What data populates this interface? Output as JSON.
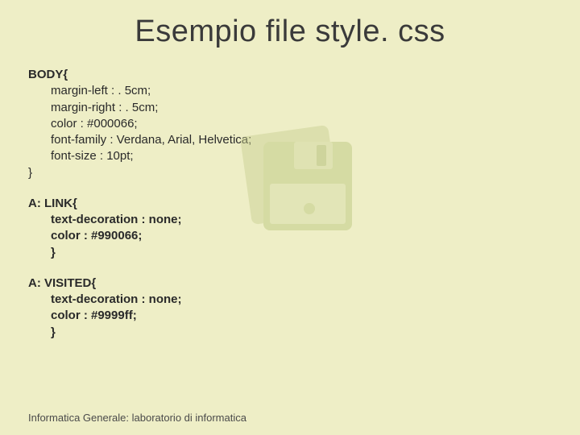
{
  "title": "Esempio file style. css",
  "code": {
    "body_sel": "BODY{",
    "body_p1": "margin-left : . 5cm;",
    "body_p2": "margin-right : . 5cm;",
    "body_p3": "color : #000066;",
    "body_p4": "font-family : Verdana, Arial, Helvetica;",
    "body_p5": "font-size : 10pt;",
    "body_close": "}",
    "alink_sel": "A: LINK{",
    "alink_p1": "text-decoration : none;",
    "alink_p2": "color : #990066;",
    "alink_close": "}",
    "avis_sel": "A: VISITED{",
    "avis_p1": "text-decoration : none;",
    "avis_p2": "color : #9999ff;",
    "avis_close": "}"
  },
  "footer": "Informatica Generale: laboratorio di informatica"
}
